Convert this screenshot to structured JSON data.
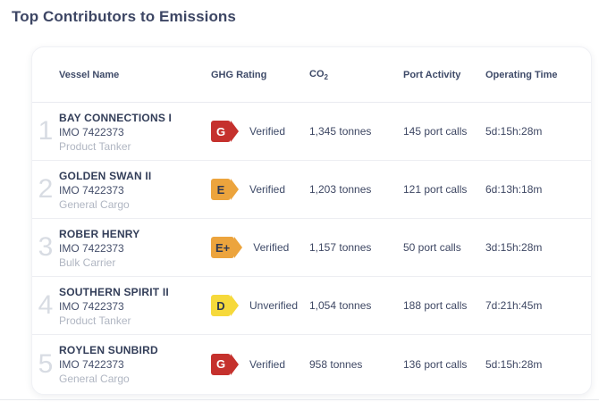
{
  "title": "Top Contributors to Emissions",
  "table": {
    "headers": {
      "vessel": "Vessel Name",
      "ghg": "GHG Rating",
      "co2_main": "CO",
      "co2_sub": "2",
      "port": "Port Activity",
      "time": "Operating Time"
    },
    "rows": [
      {
        "rank": "1",
        "name": "BAY CONNECTIONS I",
        "imo": "IMO 7422373",
        "type": "Product Tanker",
        "rating": {
          "letter": "G",
          "bg": "#c5312d",
          "fg": "#ffffff"
        },
        "status": "Verified",
        "co2": "1,345 tonnes",
        "port_calls": "145 port calls",
        "operating_time": "5d:15h:28m"
      },
      {
        "rank": "2",
        "name": "GOLDEN SWAN II",
        "imo": "IMO 7422373",
        "type": "General Cargo",
        "rating": {
          "letter": "E",
          "bg": "#eca43d",
          "fg": "#2f3850"
        },
        "status": "Verified",
        "co2": "1,203 tonnes",
        "port_calls": "121 port calls",
        "operating_time": "6d:13h:18m"
      },
      {
        "rank": "3",
        "name": "ROBER HENRY",
        "imo": "IMO 7422373",
        "type": "Bulk Carrier",
        "rating": {
          "letter": "E+",
          "bg": "#eca43d",
          "fg": "#2f3850"
        },
        "status": "Verified",
        "co2": "1,157 tonnes",
        "port_calls": "50 port calls",
        "operating_time": "3d:15h:28m"
      },
      {
        "rank": "4",
        "name": "SOUTHERN SPIRIT II",
        "imo": "IMO 7422373",
        "type": "Product Tanker",
        "rating": {
          "letter": "D",
          "bg": "#f6d93b",
          "fg": "#2f3850"
        },
        "status": "Unverified",
        "co2": "1,054 tonnes",
        "port_calls": "188 port calls",
        "operating_time": "7d:21h:45m"
      },
      {
        "rank": "5",
        "name": "ROYLEN SUNBIRD",
        "imo": "IMO 7422373",
        "type": "General Cargo",
        "rating": {
          "letter": "G",
          "bg": "#c5312d",
          "fg": "#ffffff"
        },
        "status": "Verified",
        "co2": "958 tonnes",
        "port_calls": "136 port calls",
        "operating_time": "5d:15h:28m"
      }
    ]
  },
  "colors": {
    "title_text": "#3d4664",
    "header_text": "#3e4a68",
    "muted_text": "#b0b6c2",
    "rank_text": "#d8dce3",
    "divider": "#edeef2",
    "rating_red": "#c5312d",
    "rating_orange": "#eca43d",
    "rating_yellow": "#f6d93b"
  }
}
